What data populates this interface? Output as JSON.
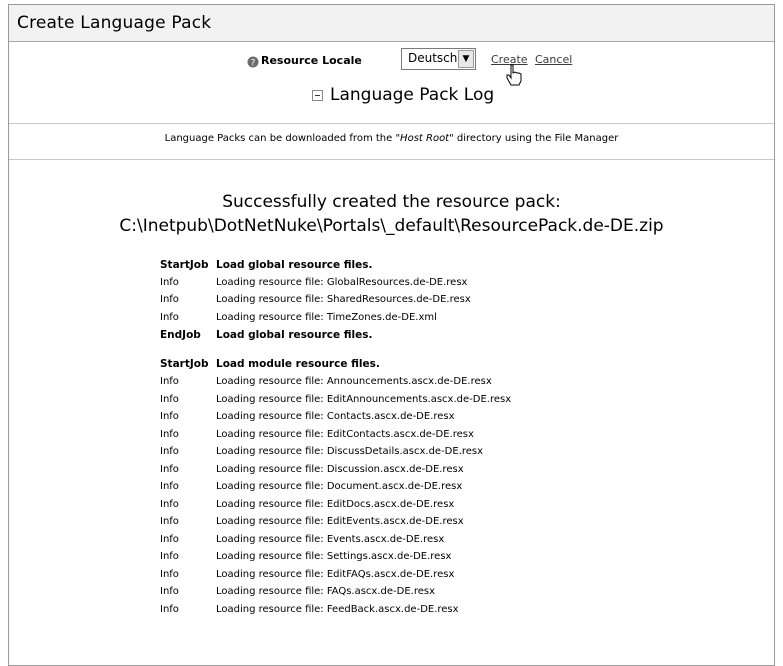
{
  "title": "Create Language Pack",
  "locale": {
    "label": "Resource Locale",
    "selected": "Deutsch",
    "create_label": "Create",
    "cancel_label": "Cancel"
  },
  "log_section": {
    "title": "Language Pack Log",
    "note_prefix": "Language Packs can be downloaded from the ",
    "note_em": "\"Host Root\"",
    "note_suffix": " directory using the File Manager"
  },
  "result": {
    "line1": "Successfully created the resource pack:",
    "line2": "C:\\Inetpub\\DotNetNuke\\Portals\\_default\\ResourcePack.de-DE.zip"
  },
  "log": [
    {
      "type": "StartJob",
      "message": "Load global resource files.",
      "bold": true
    },
    {
      "type": "Info",
      "message": "Loading resource file: GlobalResources.de-DE.resx"
    },
    {
      "type": "Info",
      "message": "Loading resource file: SharedResources.de-DE.resx"
    },
    {
      "type": "Info",
      "message": "Loading resource file: TimeZones.de-DE.xml"
    },
    {
      "type": "EndJob",
      "message": "Load global resource files.",
      "bold": true
    },
    {
      "type": "",
      "message": "",
      "gap": true
    },
    {
      "type": "StartJob",
      "message": "Load module resource files.",
      "bold": true
    },
    {
      "type": "Info",
      "message": "Loading resource file: Announcements.ascx.de-DE.resx"
    },
    {
      "type": "Info",
      "message": "Loading resource file: EditAnnouncements.ascx.de-DE.resx"
    },
    {
      "type": "Info",
      "message": "Loading resource file: Contacts.ascx.de-DE.resx"
    },
    {
      "type": "Info",
      "message": "Loading resource file: EditContacts.ascx.de-DE.resx"
    },
    {
      "type": "Info",
      "message": "Loading resource file: DiscussDetails.ascx.de-DE.resx"
    },
    {
      "type": "Info",
      "message": "Loading resource file: Discussion.ascx.de-DE.resx"
    },
    {
      "type": "Info",
      "message": "Loading resource file: Document.ascx.de-DE.resx"
    },
    {
      "type": "Info",
      "message": "Loading resource file: EditDocs.ascx.de-DE.resx"
    },
    {
      "type": "Info",
      "message": "Loading resource file: EditEvents.ascx.de-DE.resx"
    },
    {
      "type": "Info",
      "message": "Loading resource file: Events.ascx.de-DE.resx"
    },
    {
      "type": "Info",
      "message": "Loading resource file: Settings.ascx.de-DE.resx"
    },
    {
      "type": "Info",
      "message": "Loading resource file: EditFAQs.ascx.de-DE.resx"
    },
    {
      "type": "Info",
      "message": "Loading resource file: FAQs.ascx.de-DE.resx"
    },
    {
      "type": "Info",
      "message": "Loading resource file: FeedBack.ascx.de-DE.resx"
    }
  ]
}
